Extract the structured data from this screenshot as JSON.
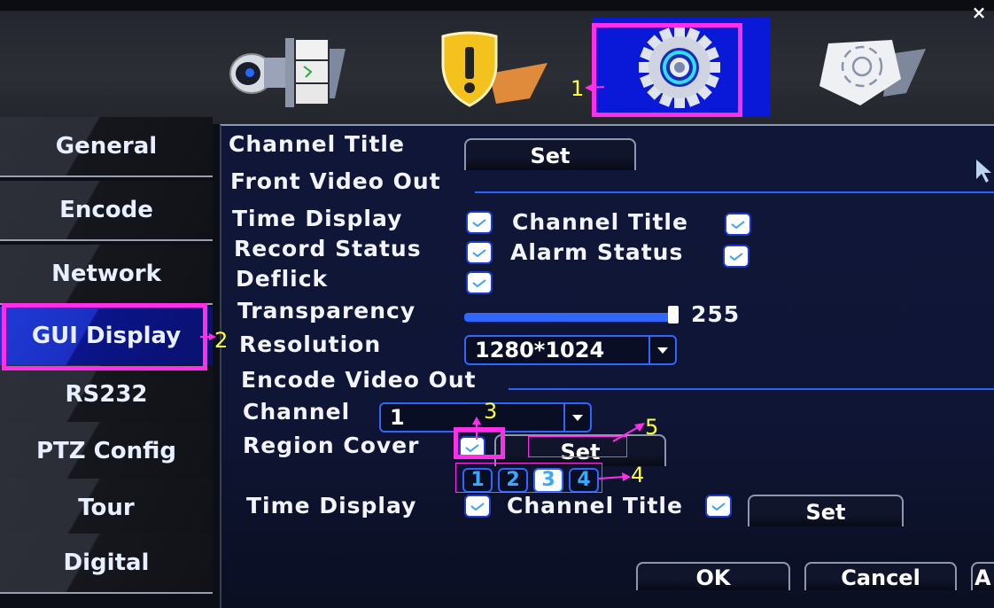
{
  "window": {
    "close_label": "×"
  },
  "top_icons": [
    {
      "name": "record",
      "icon": "camera-film-icon"
    },
    {
      "name": "alarm",
      "icon": "warning-shield-icon"
    },
    {
      "name": "system",
      "icon": "gear-icon",
      "selected": true
    },
    {
      "name": "advanced",
      "icon": "gear-document-icon"
    }
  ],
  "sidebar": {
    "items": [
      {
        "label": "General"
      },
      {
        "label": "Encode"
      },
      {
        "label": "Network"
      },
      {
        "label": "GUI Display",
        "active": true
      },
      {
        "label": "RS232"
      },
      {
        "label": "PTZ Config"
      },
      {
        "label": "Tour"
      },
      {
        "label": "Digital"
      }
    ]
  },
  "panel": {
    "channel_title_label": "Channel Title",
    "channel_title_set": "Set",
    "front_video_out": {
      "heading": "Front Video Out",
      "time_display": {
        "label": "Time Display",
        "checked": true
      },
      "channel_title": {
        "label": "Channel Title",
        "checked": true
      },
      "record_status": {
        "label": "Record Status",
        "checked": true
      },
      "alarm_status": {
        "label": "Alarm Status",
        "checked": true
      },
      "deflick": {
        "label": "Deflick",
        "checked": true
      },
      "transparency": {
        "label": "Transparency",
        "value": "255",
        "min": 128,
        "max": 255,
        "current": 255
      },
      "resolution": {
        "label": "Resolution",
        "value": "1280*1024"
      }
    },
    "encode_video_out": {
      "heading": "Encode Video Out",
      "channel": {
        "label": "Channel",
        "value": "1"
      },
      "region_cover": {
        "label": "Region Cover",
        "checked": true,
        "set_label": "Set"
      },
      "regions": [
        "1",
        "2",
        "3",
        "4"
      ],
      "selected_region": "3",
      "time_display": {
        "label": "Time Display",
        "checked": true
      },
      "channel_title": {
        "label": "Channel Title",
        "checked": true
      },
      "set_label": "Set"
    },
    "buttons": {
      "ok": "OK",
      "cancel": "Cancel",
      "apply_partial": "A"
    }
  },
  "annotations": {
    "colors": {
      "box": "#ff2ee8",
      "number": "#ffff2e"
    },
    "labels": [
      "1",
      "2",
      "3",
      "4",
      "5"
    ]
  }
}
